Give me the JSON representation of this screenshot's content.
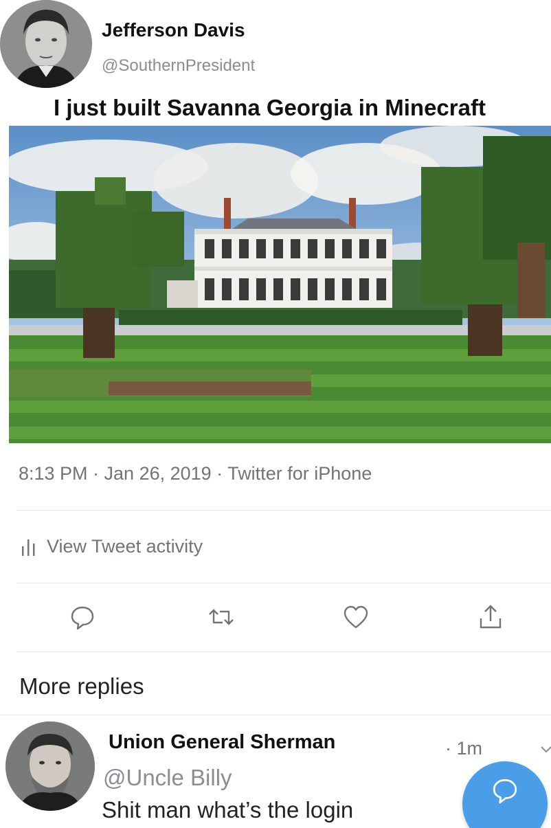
{
  "tweet": {
    "author_name": "Jefferson Davis",
    "author_handle": "@SouthernPresident",
    "text": "I just built Savanna Georgia in Minecraft",
    "image_icon": "minecraft-mansion-image",
    "meta": "8:13 PM · Jan 26, 2019 · Twitter for iPhone"
  },
  "activity": {
    "label": "View Tweet activity",
    "icon": "bar-chart-icon"
  },
  "actions": [
    {
      "icon": "reply-icon"
    },
    {
      "icon": "retweet-icon"
    },
    {
      "icon": "like-icon"
    },
    {
      "icon": "share-icon"
    }
  ],
  "more_replies_label": "More replies",
  "reply": {
    "author_name": "Union General Sherman",
    "author_handle": "@Uncle Billy",
    "time": "· 1m",
    "text": "Shit man what’s the login"
  },
  "colors": {
    "accent": "#4a9ee7",
    "muted_text": "#6f7479",
    "divider": "#e3e6e8"
  }
}
